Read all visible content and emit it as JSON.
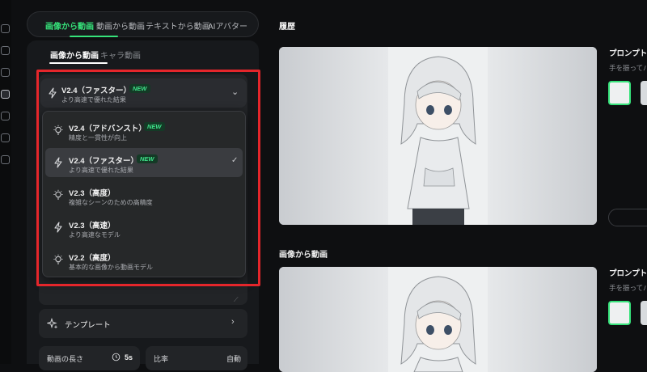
{
  "main_tabs": [
    {
      "label": "画像から動画",
      "active": true
    },
    {
      "label": "動画から動画",
      "active": false
    },
    {
      "label": "テキストから動画",
      "active": false
    },
    {
      "label": "AIアバター",
      "active": false
    }
  ],
  "sub_tabs": [
    {
      "label": "画像から動画",
      "active": true
    },
    {
      "label": "キャラ動画",
      "active": false
    }
  ],
  "model_selector": {
    "name": "V2.4（ファスター）",
    "badge": "NEW",
    "description": "より高速で優れた結果",
    "icon": "lightning-icon"
  },
  "model_options": [
    {
      "name": "V2.4（アドバンスト）",
      "badge": "NEW",
      "description": "精度と一貫性が向上",
      "icon": "bulb-icon",
      "selected": false
    },
    {
      "name": "V2.4（ファスター）",
      "badge": "NEW",
      "description": "より高速で優れた結果",
      "icon": "lightning-icon",
      "selected": true
    },
    {
      "name": "V2.3（高度）",
      "badge": "",
      "description": "複雑なシーンのための高精度",
      "icon": "bulb-icon",
      "selected": false
    },
    {
      "name": "V2.3（高速）",
      "badge": "",
      "description": "より高速なモデル",
      "icon": "lightning-icon",
      "selected": false
    },
    {
      "name": "V2.2（高度）",
      "badge": "",
      "description": "基本的な画像から動画モデル",
      "icon": "bulb-icon",
      "selected": false
    }
  ],
  "template": {
    "label": "テンプレート",
    "icon": "sparkle-icon"
  },
  "duration": {
    "label": "動画の長さ",
    "value": "5s",
    "icon": "clock-icon"
  },
  "ratio": {
    "label": "比率",
    "value": "自動"
  },
  "history": {
    "title": "履歴"
  },
  "history_item_2": {
    "title": "画像から動画"
  },
  "right_panel": {
    "prompt_label": "プロンプト(",
    "prompt_text": "手を振ってパ",
    "prompt_label_2": "プロンプト(",
    "prompt_text_2": "手を振ってパ"
  },
  "colors": {
    "accent": "#36e27a",
    "highlight_box": "#e5262b",
    "background": "#0e0f11",
    "panel": "#17191c"
  }
}
